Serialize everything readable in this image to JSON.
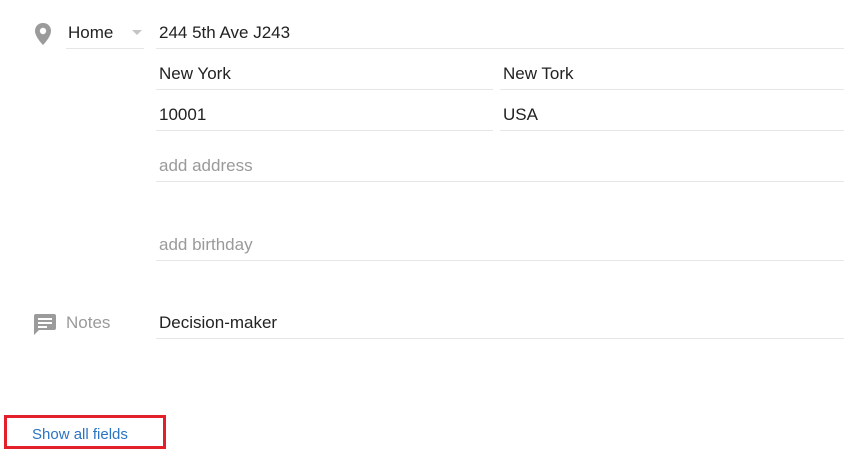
{
  "address": {
    "icon": "location-pin-icon",
    "type_label": "Home",
    "street": "244 5th Ave J243",
    "city": "New York",
    "state": "New Tork",
    "zip": "10001",
    "country": "USA",
    "add_address_placeholder": "add address"
  },
  "birthday": {
    "placeholder": "add birthday"
  },
  "notes": {
    "icon": "notes-icon",
    "label": "Notes",
    "value": "Decision-maker"
  },
  "footer": {
    "show_all_fields_label": "Show all fields",
    "link_color": "#2a74c4",
    "highlight_color": "#e3202a"
  }
}
